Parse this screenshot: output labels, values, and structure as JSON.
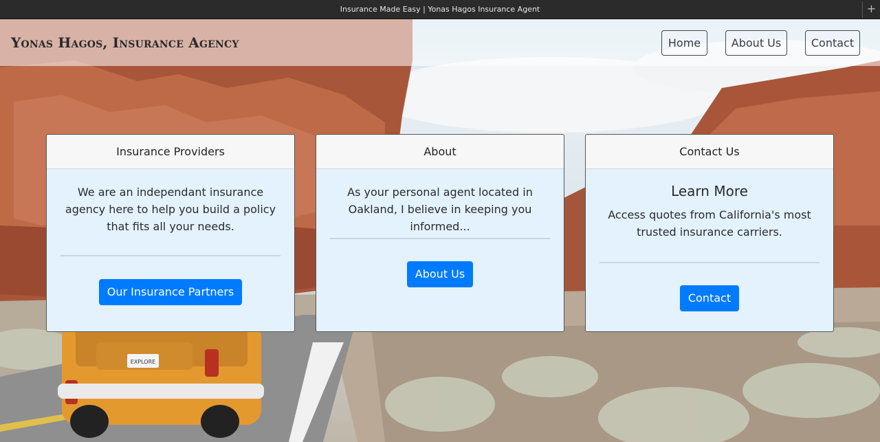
{
  "window": {
    "title": "Insurance Made Easy | Yonas Hagos Insurance Agent",
    "new_tab_symbol": "+"
  },
  "header": {
    "brand": "Yonas Hagos, Insurance Agency",
    "nav": [
      {
        "label": "Home"
      },
      {
        "label": "About Us"
      },
      {
        "label": "Contact"
      }
    ]
  },
  "cards": [
    {
      "header": "Insurance Providers",
      "text": "We are an independant insurance agency here to help you build a policy that fits all your needs.",
      "button": "Our Insurance Partners"
    },
    {
      "header": "About",
      "text": "As your personal agent located in Oakland, I believe in keeping you informed...",
      "button": "About Us"
    },
    {
      "header": "Contact Us",
      "title": "Learn More",
      "text": "Access quotes from California's most trusted insurance carriers.",
      "button": "Contact"
    }
  ],
  "background": {
    "van_plate": "EXPLORE"
  },
  "colors": {
    "primary": "#007bff",
    "card_bg": "#e3f2fd",
    "card_header_bg": "#f7f7f7"
  }
}
